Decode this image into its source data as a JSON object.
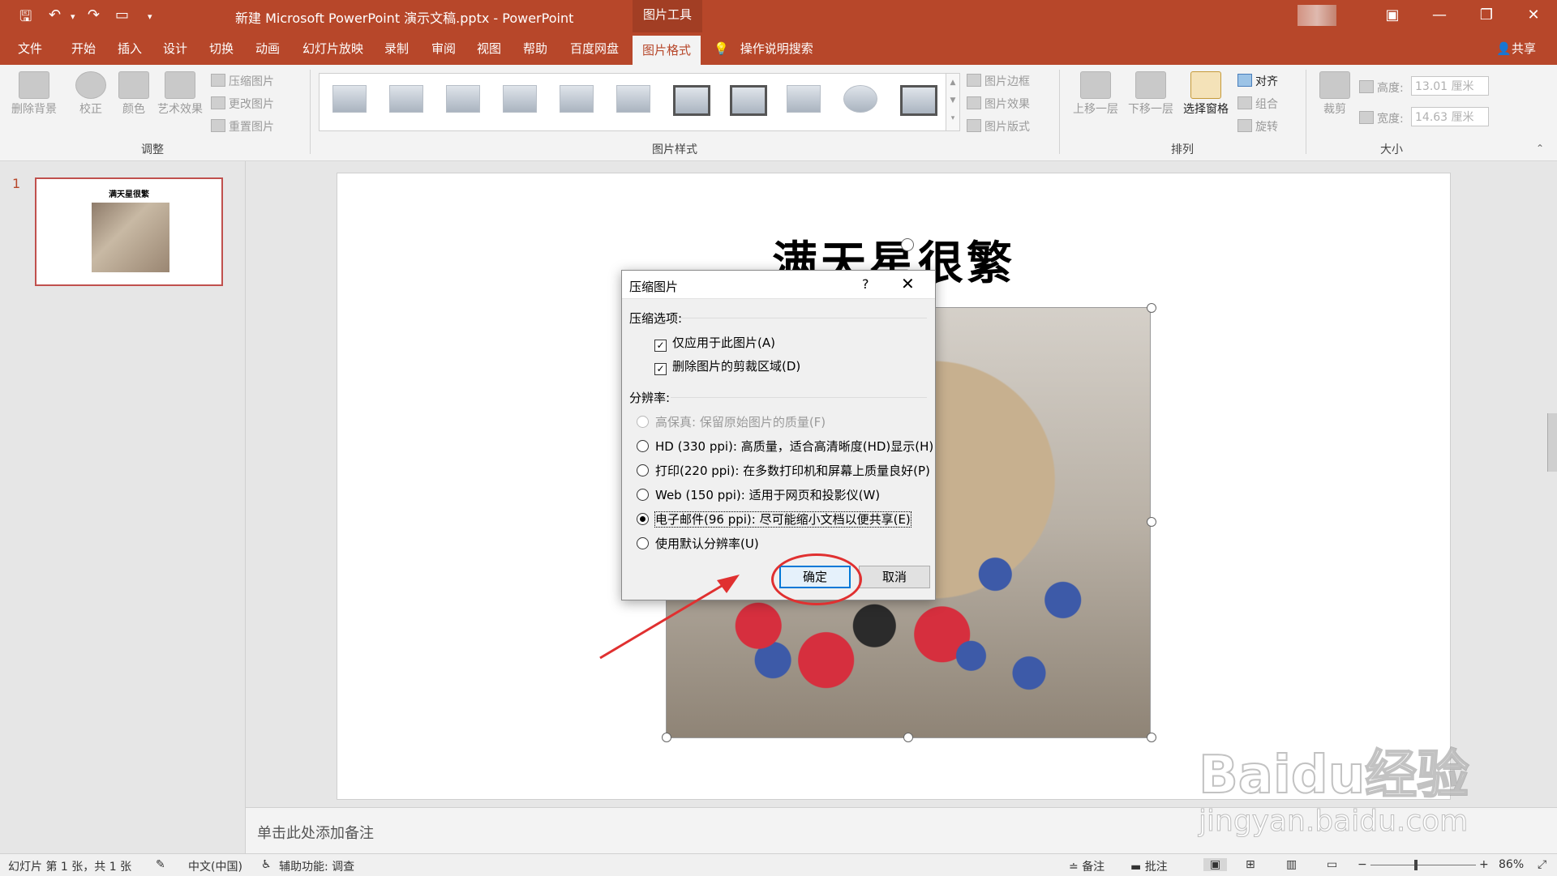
{
  "titlebar": {
    "document_title": "新建 Microsoft PowerPoint 演示文稿.pptx  -  PowerPoint",
    "context_tab": "图片工具",
    "quick_access": {
      "save": "save-icon",
      "undo": "undo-icon",
      "redo": "redo-icon",
      "present": "present-icon"
    },
    "window_controls": {
      "minimize": "—",
      "restore": "❐",
      "close": "✕",
      "ribbon_display": "▣"
    }
  },
  "tabs": [
    "文件",
    "开始",
    "插入",
    "设计",
    "切换",
    "动画",
    "幻灯片放映",
    "录制",
    "审阅",
    "视图",
    "帮助",
    "百度网盘",
    "图片格式"
  ],
  "active_tab": "图片格式",
  "search_label": "操作说明搜索",
  "share_label": "共享",
  "ribbon": {
    "adjust": {
      "remove_bg": "删除背景",
      "correct": "校正",
      "color": "颜色",
      "artistic": "艺术效果",
      "compress": "压缩图片",
      "change": "更改图片",
      "reset": "重置图片",
      "group_label": "调整"
    },
    "styles": {
      "border": "图片边框",
      "effects": "图片效果",
      "layout": "图片版式",
      "group_label": "图片样式"
    },
    "arrange": {
      "bring_forward": "上移一层",
      "send_backward": "下移一层",
      "selection_pane": "选择窗格",
      "align": "对齐",
      "group": "组合",
      "rotate": "旋转",
      "group_label": "排列"
    },
    "size": {
      "crop": "裁剪",
      "height_label": "高度:",
      "height_value": "13.01 厘米",
      "width_label": "宽度:",
      "width_value": "14.63 厘米",
      "group_label": "大小"
    }
  },
  "slides_panel": {
    "slide_number": "1",
    "thumb_title": "满天星很繁"
  },
  "slide": {
    "title": "满天星很繁"
  },
  "notes_placeholder": "单击此处添加备注",
  "status": {
    "slide_info": "幻灯片 第 1 张，共 1 张",
    "language": "中文(中国)",
    "accessibility": "辅助功能: 调查",
    "notes": "备注",
    "comments": "批注",
    "zoom_minus": "−",
    "zoom_plus": "+",
    "zoom_level": "86%"
  },
  "dialog": {
    "title": "压缩图片",
    "help": "?",
    "close": "✕",
    "compress_section": "压缩选项:",
    "opt_apply_only": "仅应用于此图片(A)",
    "opt_delete_crop": "删除图片的剪裁区域(D)",
    "resolution_section": "分辨率:",
    "res_hifi": "高保真: 保留原始图片的质量(F)",
    "res_hd": "HD (330 ppi): 高质量，适合高清晰度(HD)显示(H)",
    "res_print": "打印(220 ppi): 在多数打印机和屏幕上质量良好(P)",
    "res_web": "Web (150 ppi): 适用于网页和投影仪(W)",
    "res_email": "电子邮件(96 ppi): 尽可能缩小文档以便共享(E)",
    "res_default": "使用默认分辨率(U)",
    "ok": "确定",
    "cancel": "取消"
  },
  "watermark": {
    "logo": "Baidu经验",
    "url": "jingyan.baidu.com"
  },
  "colors": {
    "brand": "#b7472a",
    "annotation": "#e03030",
    "focus_blue": "#0078d7"
  }
}
